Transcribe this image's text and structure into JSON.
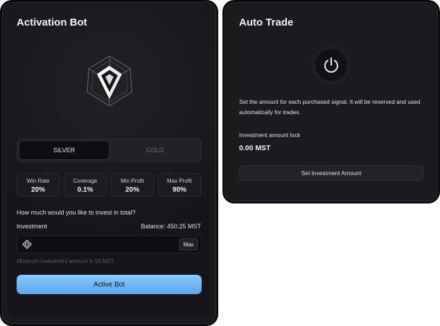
{
  "activation": {
    "title": "Activation Bot",
    "tiers": [
      "SILVER",
      "GOLD"
    ],
    "selected_tier": "SILVER",
    "stats": [
      {
        "label": "Win Rate",
        "value": "20%"
      },
      {
        "label": "Coverage",
        "value": "0.1%"
      },
      {
        "label": "Min Profit",
        "value": "20%"
      },
      {
        "label": "Max Profit",
        "value": "90%"
      }
    ],
    "question": "How much would you like to invest in total?",
    "investment_label": "Investment",
    "balance": "Balance: 450.25 MST",
    "input_value": "",
    "max_label": "Max",
    "min_note": "Minimum investment amount is 10 MST.",
    "active_button": "Active Bot"
  },
  "auto_trade": {
    "title": "Auto Trade",
    "description": "Set the amount for each purchased signal. It will be reserved and used automatically for trades.",
    "lock_label": "Investment amount lock",
    "lock_value": "0.00 MST",
    "set_button": "Set Investment Amount"
  },
  "colors": {
    "panel_bg": "#1a1a1d",
    "accent_gradient_start": "#8cc9ff",
    "accent_gradient_end": "#5aa6ee"
  },
  "icons": {
    "bot_logo": "diamond-emblem-icon",
    "token": "token-icon",
    "power": "power-icon"
  }
}
